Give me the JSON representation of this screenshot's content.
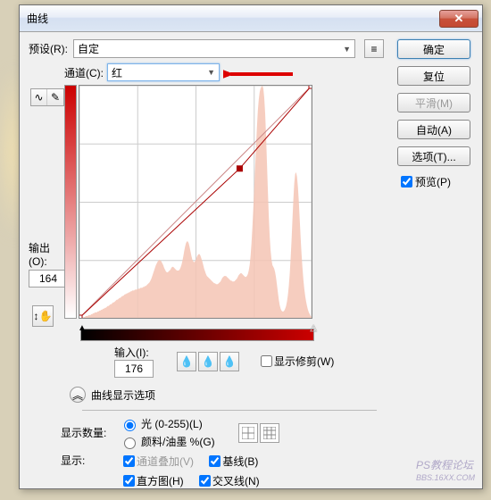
{
  "titlebar": {
    "title": "曲线"
  },
  "preset": {
    "label": "预设(R):",
    "value": "自定"
  },
  "channel": {
    "label": "通道(C):",
    "value": "红"
  },
  "output": {
    "label": "输出(O):",
    "value": "164"
  },
  "input": {
    "label": "输入(I):",
    "value": "176"
  },
  "show_clipping": {
    "label": "显示修剪(W)"
  },
  "disclosure": {
    "label": "曲线显示选项"
  },
  "amount": {
    "label": "显示数量:",
    "opt_light": "光 (0-255)(L)",
    "opt_ink": "颜料/油墨 %(G)"
  },
  "show": {
    "label": "显示:",
    "overlay": "通道叠加(V)",
    "baseline": "基线(B)",
    "histogram": "直方图(H)",
    "intersection": "交叉线(N)"
  },
  "buttons": {
    "ok": "确定",
    "reset": "复位",
    "smooth": "平滑(M)",
    "auto": "自动(A)",
    "options": "选项(T)..."
  },
  "preview": {
    "label": "预览(P)"
  },
  "watermark": "PS教程论坛",
  "watermark2": "BBS.16XX.COM",
  "chart_data": {
    "type": "curve",
    "xrange": [
      0,
      255
    ],
    "yrange": [
      0,
      255
    ],
    "grid": [
      0,
      64,
      128,
      192,
      255
    ],
    "curve_points": [
      [
        0,
        0
      ],
      [
        176,
        164
      ],
      [
        255,
        255
      ]
    ],
    "baseline": [
      [
        0,
        0
      ],
      [
        255,
        255
      ]
    ],
    "histogram_color": "#f4c4b4",
    "histogram": [
      0,
      0,
      0,
      0,
      0,
      1,
      1,
      2,
      2,
      2,
      3,
      3,
      3,
      4,
      4,
      5,
      5,
      6,
      6,
      6,
      7,
      7,
      8,
      8,
      9,
      9,
      10,
      10,
      11,
      11,
      12,
      13,
      13,
      14,
      15,
      15,
      16,
      17,
      17,
      18,
      19,
      20,
      20,
      21,
      22,
      22,
      23,
      24,
      24,
      25,
      26,
      26,
      27,
      27,
      28,
      28,
      29,
      29,
      30,
      30,
      30,
      31,
      31,
      31,
      32,
      32,
      32,
      33,
      33,
      33,
      34,
      34,
      35,
      35,
      36,
      37,
      38,
      39,
      41,
      43,
      46,
      49,
      52,
      55,
      58,
      60,
      62,
      63,
      64,
      63,
      62,
      60,
      58,
      55,
      53,
      51,
      50,
      50,
      51,
      52,
      53,
      55,
      56,
      56,
      55,
      54,
      53,
      52,
      52,
      52,
      53,
      55,
      58,
      62,
      67,
      73,
      78,
      82,
      84,
      84,
      82,
      78,
      73,
      68,
      64,
      62,
      61,
      62,
      64,
      67,
      69,
      70,
      70,
      68,
      65,
      62,
      58,
      54,
      51,
      48,
      46,
      45,
      44,
      43,
      42,
      41,
      40,
      39,
      38,
      38,
      37,
      37,
      37,
      38,
      39,
      40,
      42,
      44,
      45,
      46,
      46,
      46,
      45,
      44,
      43,
      42,
      41,
      41,
      40,
      40,
      40,
      41,
      42,
      43,
      45,
      47,
      48,
      49,
      49,
      48,
      47,
      46,
      45,
      45,
      46,
      48,
      52,
      58,
      68,
      82,
      100,
      120,
      142,
      165,
      188,
      210,
      228,
      240,
      248,
      252,
      254,
      255,
      252,
      242,
      225,
      200,
      170,
      140,
      112,
      90,
      74,
      64,
      58,
      56,
      54,
      50,
      44,
      36,
      28,
      20,
      14,
      10,
      8,
      7,
      7,
      8,
      10,
      13,
      18,
      25,
      35,
      48,
      65,
      85,
      108,
      130,
      148,
      158,
      160,
      155,
      144,
      128,
      108,
      88,
      70,
      55,
      42,
      32,
      24,
      18,
      13,
      9,
      6,
      4,
      2,
      1
    ]
  }
}
